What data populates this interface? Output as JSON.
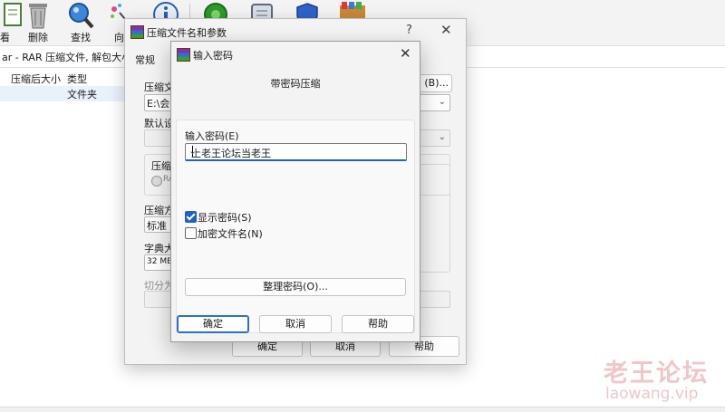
{
  "toolbar": {
    "items": [
      {
        "label": "看",
        "icon": "view-icon"
      },
      {
        "label": "删除",
        "icon": "trash-icon"
      },
      {
        "label": "查找",
        "icon": "search-icon"
      },
      {
        "label": "向",
        "icon": "wizard-icon"
      },
      {
        "label": "",
        "icon": "info-icon"
      },
      {
        "label": "",
        "icon": "virus-scan-icon"
      },
      {
        "label": "",
        "icon": "comment-icon"
      },
      {
        "label": "",
        "icon": "protect-icon"
      },
      {
        "label": "",
        "icon": "sfx-icon"
      }
    ]
  },
  "pathbar": {
    "text": "ar - RAR 压缩文件, 解包大小为"
  },
  "filelist": {
    "columns": [
      "压缩后大小",
      "类型"
    ],
    "rows": [
      {
        "type": "文件夹"
      }
    ]
  },
  "archive_dialog": {
    "title": "压缩文件名和参数",
    "help": "?",
    "close": "✕",
    "tab": "常规",
    "archive_name_label": "压缩文",
    "archive_name_value": "E:\\会中",
    "browse_button": "(B)...",
    "default_settings_label": "默认设",
    "format_label": "压缩",
    "format_option": "RA",
    "method_label": "压缩方",
    "method_value": "标准",
    "dict_label": "字典大",
    "dict_value": "32 MB",
    "split_label": "切分为",
    "options_paren": ")",
    "ok": "确定",
    "cancel": "取消",
    "help_button": "帮助"
  },
  "password_dialog": {
    "title": "输入密码",
    "close": "✕",
    "header": "带密码压缩",
    "enter_label": "输入密码(E)",
    "password_value": "上老王论坛当老王",
    "show_password_label": "显示密码(S)",
    "show_password_checked": true,
    "encrypt_names_label": "加密文件名(N)",
    "encrypt_names_checked": false,
    "organize_button": "整理密码(O)...",
    "ok": "确定",
    "cancel": "取消",
    "help": "帮助"
  },
  "watermark": {
    "cn": "老王论坛",
    "en": "laowang.vip"
  },
  "colors": {
    "accent": "#1f63c6",
    "watermark": "#f2c6c6",
    "dialog_bg": "#f3f3f3"
  }
}
